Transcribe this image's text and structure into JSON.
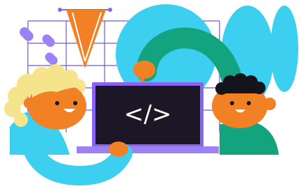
{
  "screen": {
    "code_glyph": "</>"
  },
  "colors": {
    "background": "#ffffff",
    "grid_line": "#6a5ad8",
    "purple": "#7b5cf0",
    "purple_light": "#9d82f5",
    "orange": "#f28126",
    "cyan": "#3ccfef",
    "green": "#14a37f",
    "yellow_hair": "#f6e48c",
    "dark": "#14141f",
    "laptop_screen": "#1b1726",
    "laptop_frame": "#8a63f3"
  },
  "icons": {
    "screen_symbol": "code-brackets-icon",
    "pennant": "orange-pennant-icon",
    "pills": "purple-capsule-icons"
  }
}
